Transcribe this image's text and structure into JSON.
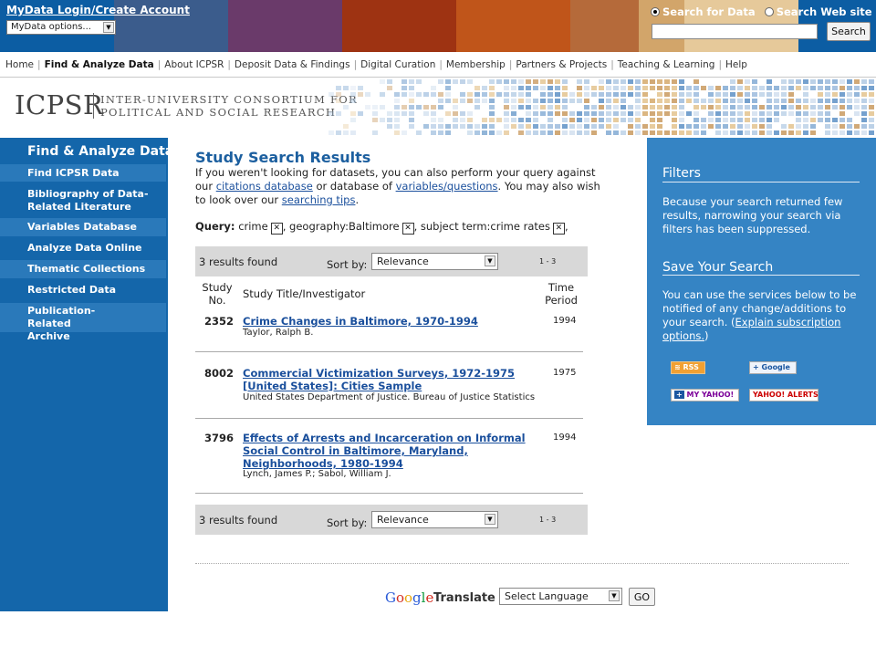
{
  "banner": {
    "mydata_link": "MyData Login/Create Account",
    "mydata_select": "MyData options...",
    "search_scope_data": "Search for Data",
    "search_scope_web": "Search Web site",
    "search_value": "",
    "search_button": "Search",
    "stripe_colors": [
      "#0c5da3",
      "#3b5c8c",
      "#6a3a6a",
      "#9e3312",
      "#c0551a",
      "#b56a3a",
      "#d2a56a",
      "#e6c99a",
      "#0c5da3"
    ]
  },
  "topnav": {
    "items": [
      "Home",
      "Find & Analyze Data",
      "About ICPSR",
      "Deposit Data & Findings",
      "Digital Curation",
      "Membership",
      "Partners & Projects",
      "Teaching & Learning",
      "Help"
    ]
  },
  "header": {
    "logo": "ICPSR",
    "subtitle_line1": "INTER-UNIVERSITY CONSORTIUM FOR",
    "subtitle_line2": "POLITICAL AND SOCIAL RESEARCH"
  },
  "sidebar": {
    "title": "Find & Analyze Data",
    "items": [
      {
        "label": "Find ICPSR Data"
      },
      {
        "label": "Bibliography of Data-Related Literature"
      },
      {
        "label": "Variables Database"
      },
      {
        "label": "Analyze Data Online"
      },
      {
        "label": "Thematic Collections"
      },
      {
        "label": "Restricted Data"
      },
      {
        "label": "Publication-Related Archive"
      }
    ]
  },
  "main": {
    "title": "Study Search Results",
    "intro": {
      "part1": "If you weren't looking for datasets, you can also perform your query against our ",
      "link1": "citations database",
      "part2": " or database of ",
      "link2": "variables/questions",
      "part3": ". You may also wish to look over our ",
      "link3": "searching tips",
      "part4": "."
    },
    "query": {
      "label": "Query:",
      "terms": [
        "crime",
        "geography:Baltimore",
        "subject term:crime rates"
      ]
    },
    "result_bar": {
      "count": "3 results found",
      "sort_label": "Sort by:",
      "sort_value": "Relevance",
      "pages": "1 - 3"
    },
    "columns": {
      "study_no": "Study No.",
      "title": "Study Title/Investigator",
      "time_period": "Time Period"
    },
    "results": [
      {
        "number": "2352",
        "title": "Crime Changes in Baltimore, 1970-1994",
        "investigator": "Taylor, Ralph B.",
        "period": "1994"
      },
      {
        "number": "8002",
        "title": "Commercial Victimization Surveys, 1972-1975 [United States]: Cities Sample",
        "investigator": "United States Department of Justice. Bureau of Justice Statistics",
        "period": "1975"
      },
      {
        "number": "3796",
        "title": "Effects of Arrests and Incarceration on Informal Social Control in Baltimore, Maryland, Neighborhoods, 1980-1994",
        "investigator": "Lynch, James P.; Sabol, William J.",
        "period": "1994"
      }
    ]
  },
  "rightpanel": {
    "filters_title": "Filters",
    "filters_text": "Because your search returned few results, narrowing your search via filters has been suppressed.",
    "save_title": "Save Your Search",
    "save_text": "You can use the services below to be notified of any change/additions to your search. (",
    "save_link": "Explain subscription options.",
    "save_text_end": ")",
    "rss": "RSS",
    "google": "Google",
    "myyahoo": "MY YAHOO!",
    "yahoo_alerts": "YAHOO! ALERTS"
  },
  "translate": {
    "google": "Google",
    "label": "Translate",
    "select": "Select Language",
    "go": "GO"
  }
}
